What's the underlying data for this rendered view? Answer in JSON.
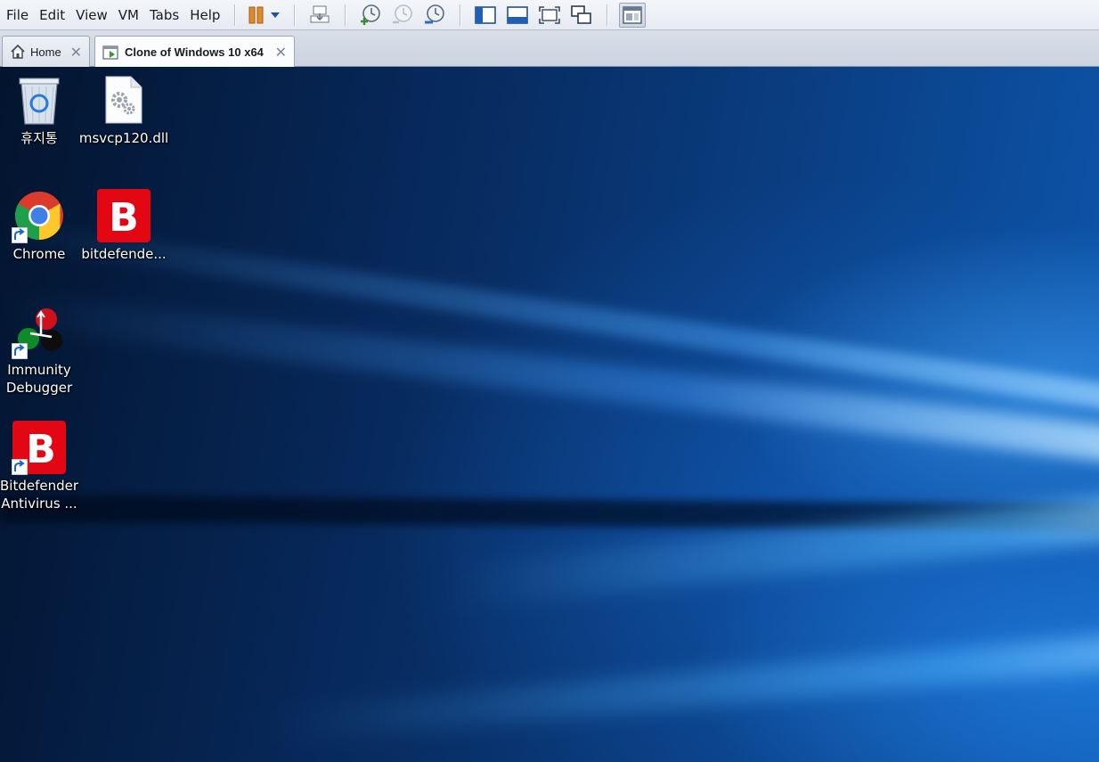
{
  "menu": {
    "items": [
      "File",
      "Edit",
      "View",
      "VM",
      "Tabs",
      "Help"
    ]
  },
  "toolbar": {
    "buttons": [
      {
        "name": "pause-icon"
      },
      {
        "name": "dropdown-arrow-icon"
      },
      {
        "name": "send-ctrl-alt-del-icon"
      },
      {
        "name": "take-snapshot-icon"
      },
      {
        "name": "revert-snapshot-icon"
      },
      {
        "name": "manage-snapshots-icon"
      },
      {
        "name": "show-library-icon"
      },
      {
        "name": "show-thumbnail-bar-icon"
      },
      {
        "name": "full-screen-icon"
      },
      {
        "name": "unity-icon"
      },
      {
        "name": "console-view-icon"
      }
    ]
  },
  "tabs": [
    {
      "label": "Home",
      "icon": "home-icon"
    },
    {
      "label": "Clone of Windows 10 x64",
      "icon": "vm-running-icon",
      "active": true
    }
  ],
  "desktop": {
    "icons": [
      {
        "label": "휴지통",
        "icon": "recycle-bin-icon"
      },
      {
        "label": "msvcp120.dll",
        "icon": "dll-file-icon"
      },
      {
        "label": "Chrome",
        "icon": "chrome-icon",
        "shortcut": true
      },
      {
        "label": "bitdefende...",
        "icon": "bitdefender-icon"
      },
      {
        "label": "Immunity\nDebugger",
        "icon": "immunity-debugger-icon",
        "shortcut": true
      },
      {
        "label": "Bitdefender\nAntivirus ...",
        "icon": "bitdefender-icon",
        "shortcut": true
      }
    ]
  },
  "colors": {
    "bitdefender_red": "#e30613",
    "desktop_blue": "#0a3d80"
  }
}
